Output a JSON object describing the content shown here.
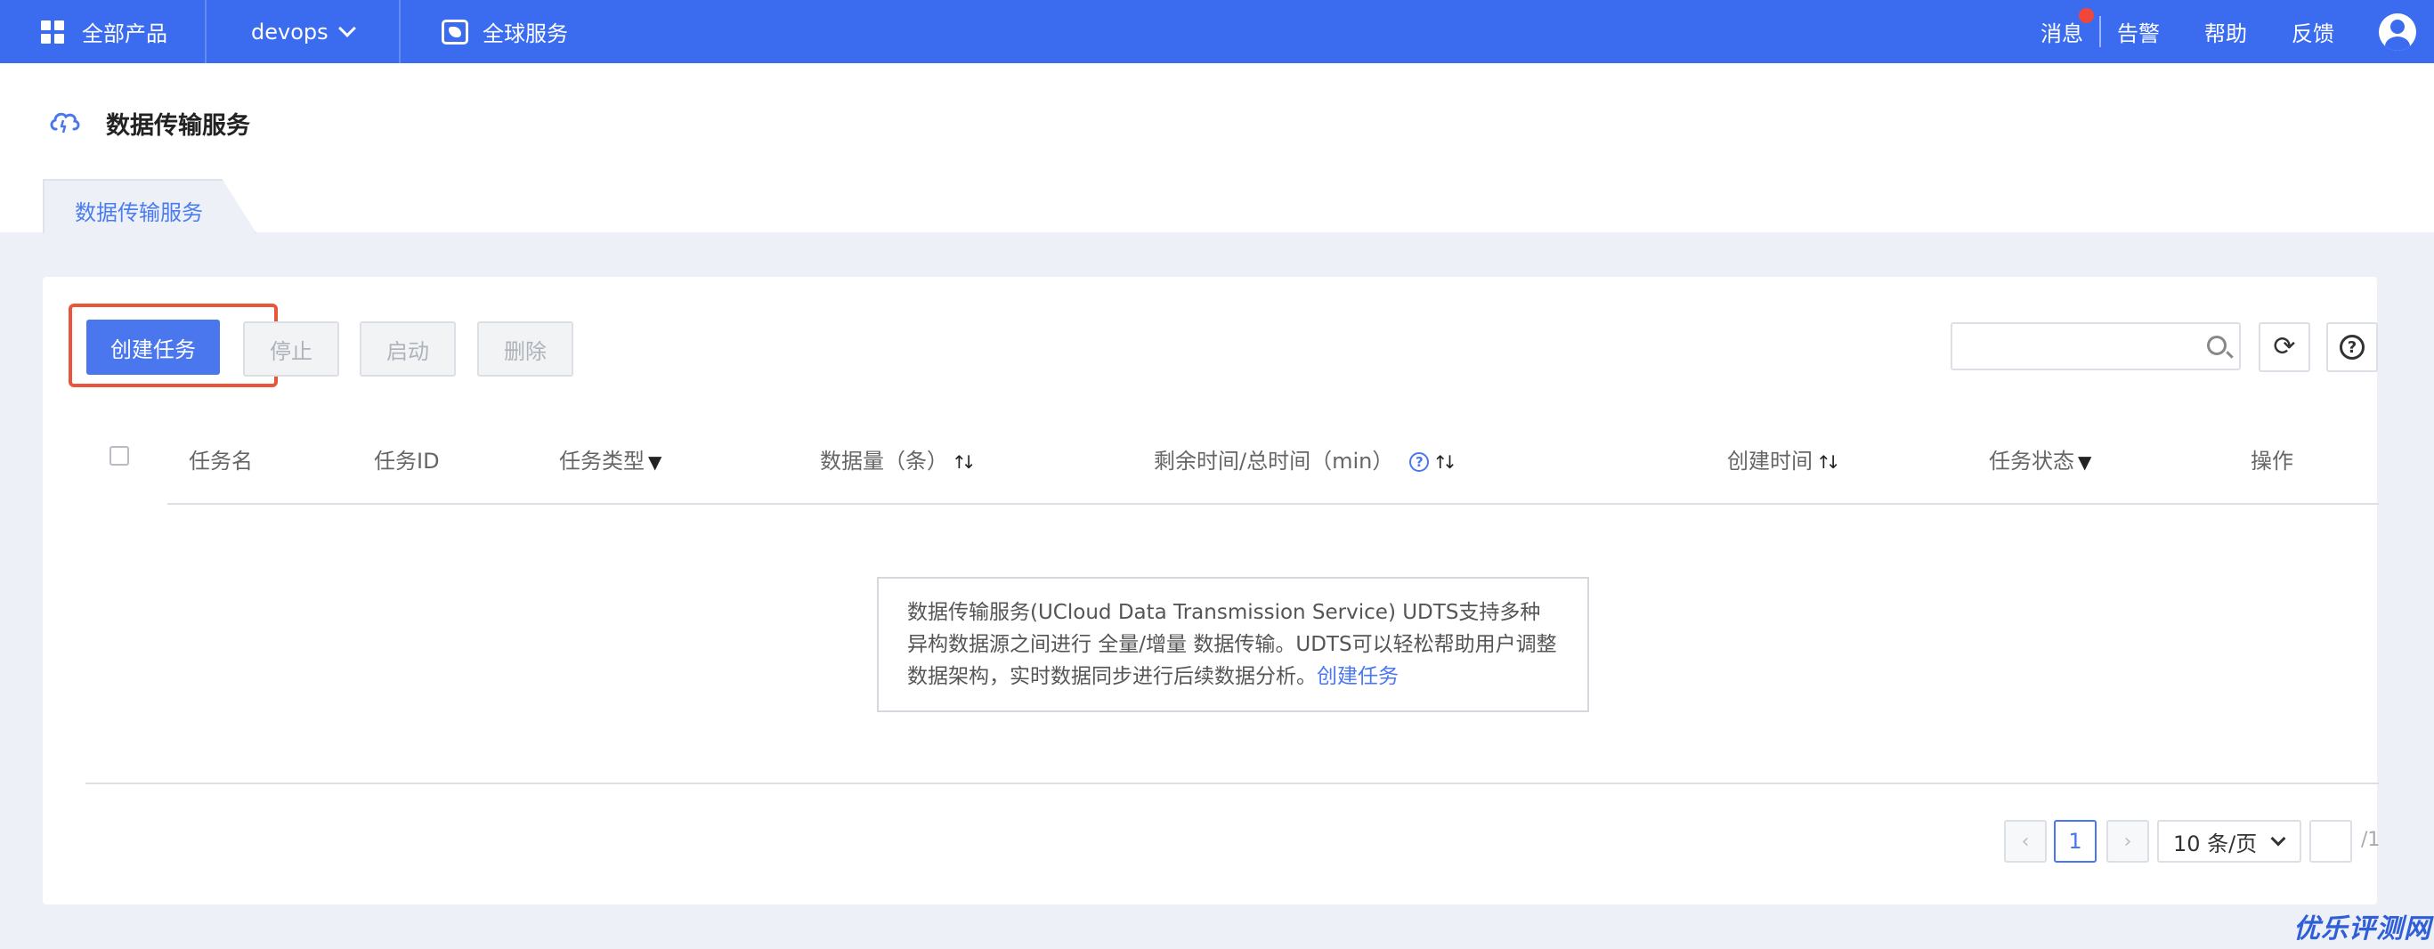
{
  "topbar": {
    "products_label": "全部产品",
    "project_label": "devops",
    "global_label": "全球服务",
    "messages_label": "消息",
    "alerts_label": "告警",
    "help_label": "帮助",
    "feedback_label": "反馈"
  },
  "page": {
    "title": "数据传输服务",
    "tab_label": "数据传输服务"
  },
  "toolbar": {
    "create_label": "创建任务",
    "stop_label": "停止",
    "start_label": "启动",
    "delete_label": "删除",
    "search_value": "",
    "refresh_icon": "refresh-icon",
    "help_icon": "help-icon"
  },
  "table": {
    "columns": [
      "任务名",
      "任务ID",
      "任务类型",
      "数据量（条）",
      "剩余时间/总时间（min）",
      "创建时间",
      "任务状态",
      "操作"
    ],
    "help_glyph": "?",
    "rows": []
  },
  "empty": {
    "text": "数据传输服务(UCloud Data Transmission Service) UDTS支持多种异构数据源之间进行 全量/增量 数据传输。UDTS可以轻松帮助用户调整数据架构，实时数据同步进行后续数据分析。",
    "link_label": "创建任务"
  },
  "pagination": {
    "prev": "‹",
    "next": "›",
    "current_page": "1",
    "page_size_label": "10 条/页",
    "jump_value": "",
    "total_pages": "/1"
  },
  "watermark": "优乐评测网",
  "colors": {
    "topbar": "#3b6cf0",
    "primary": "#4a77ee",
    "highlight": "#e8553a",
    "badge": "#f0463c"
  }
}
